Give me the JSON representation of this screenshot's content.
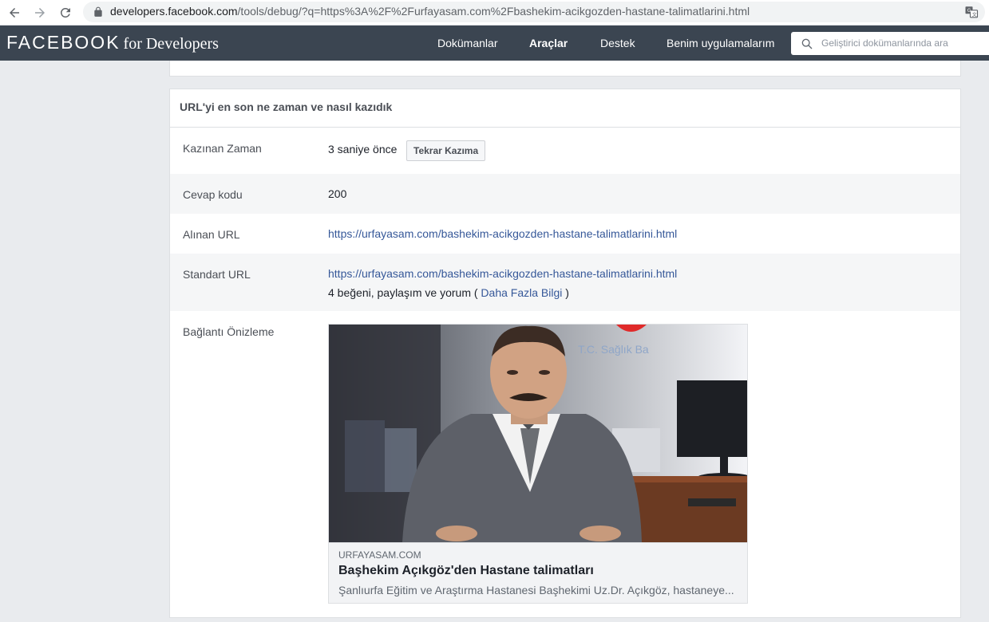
{
  "browser": {
    "url_host": "developers.facebook.com",
    "url_path": "/tools/debug/?q=https%3A%2F%2Furfayasam.com%2Fbashekim-acikgozden-hastane-talimatlarini.html"
  },
  "header": {
    "brand_main": "FACEBOOK",
    "brand_sub": "for Developers",
    "nav": [
      "Dokümanlar",
      "Araçlar",
      "Destek",
      "Benim uygulamalarım"
    ],
    "active_nav": "Araçlar",
    "search_placeholder": "Geliştirici dokümanlarında ara"
  },
  "card": {
    "title": "URL'yi en son ne zaman ve nasıl kazıdık",
    "rows": {
      "scraped_time": {
        "label": "Kazınan Zaman",
        "value": "3 saniye önce",
        "button": "Tekrar Kazıma"
      },
      "response_code": {
        "label": "Cevap kodu",
        "value": "200"
      },
      "fetched_url": {
        "label": "Alınan URL",
        "value": "https://urfayasam.com/bashekim-acikgozden-hastane-talimatlarini.html"
      },
      "canonical_url": {
        "label": "Standart URL",
        "value": "https://urfayasam.com/bashekim-acikgozden-hastane-talimatlarini.html",
        "engagement_prefix": "4 beğeni, paylaşım ve yorum (",
        "engagement_link": "Daha Fazla Bilgi",
        "engagement_suffix": ")"
      },
      "link_preview": {
        "label": "Bağlantı Önizleme"
      }
    }
  },
  "preview": {
    "domain": "URFAYASAM.COM",
    "title": "Başhekim Açıkgöz'den Hastane talimatları",
    "description": "Şanlıurfa Eğitim ve Araştırma Hastanesi Başhekimi Uz.Dr. Açıkgöz, hastaneye...",
    "image_sign_text": "T.C. Sağlık Ba"
  },
  "colors": {
    "header_bg": "#3b4551",
    "page_bg": "#e9ebee",
    "link": "#365899",
    "alt_row": "#f5f6f7"
  }
}
